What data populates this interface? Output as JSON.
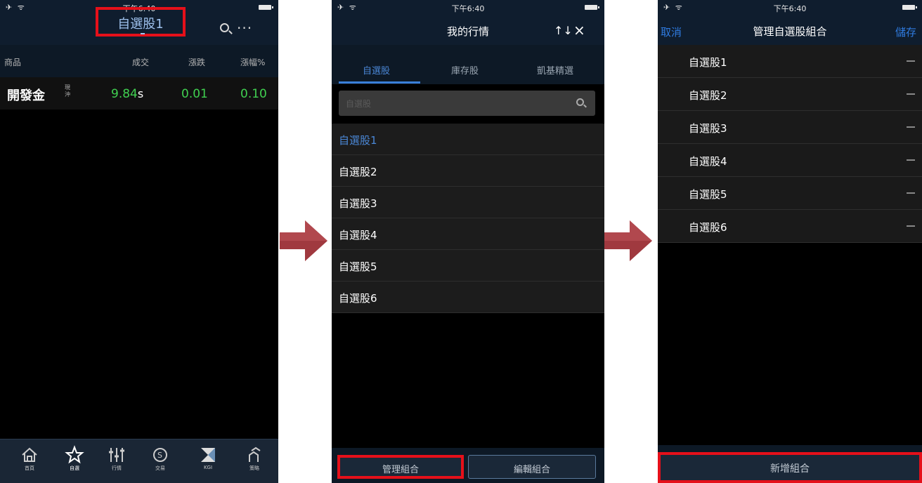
{
  "colors": {
    "highlight": "#e5101a",
    "accent_blue": "#4a87d6",
    "up_green": "#40d050",
    "arrow": "#a0393f"
  },
  "status_bar": {
    "signal": "✈ ᯤ",
    "time": "下午6:40"
  },
  "panel1": {
    "title": "自選股1",
    "columns": {
      "product": "商品",
      "deal": "成交",
      "change": "漲跌",
      "pct": "漲幅%"
    },
    "row": {
      "name": "開發金",
      "tag": "現沖",
      "price": "9.84",
      "price_suffix": "s",
      "change": "0.01",
      "pct": "0.10"
    },
    "tabs": [
      {
        "icon": "home-icon",
        "label": "首頁"
      },
      {
        "icon": "star-icon",
        "label": "自選"
      },
      {
        "icon": "quotes-icon",
        "label": "行情"
      },
      {
        "icon": "trade-icon",
        "label": "交易"
      },
      {
        "icon": "kgi-icon",
        "label": "KGI"
      },
      {
        "icon": "strategy-icon",
        "label": "策略"
      }
    ]
  },
  "panel2": {
    "title": "我的行情",
    "tabs": [
      "自選股",
      "庫存股",
      "凱基精選"
    ],
    "search_placeholder": "自選股",
    "items": [
      "自選股1",
      "自選股2",
      "自選股3",
      "自選股4",
      "自選股5",
      "自選股6"
    ],
    "buttons": {
      "manage": "管理組合",
      "edit": "編輯組合"
    }
  },
  "panel3": {
    "cancel": "取消",
    "title": "管理自選股組合",
    "save": "儲存",
    "items": [
      "自選股1",
      "自選股2",
      "自選股3",
      "自選股4",
      "自選股5",
      "自選股6"
    ],
    "add_button": "新增組合"
  }
}
